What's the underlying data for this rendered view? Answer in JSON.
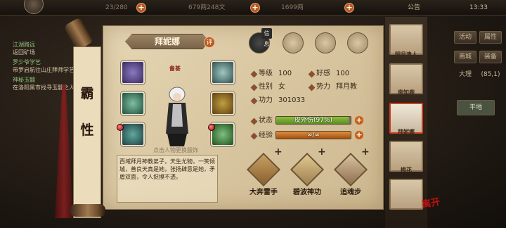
{
  "topbar": {
    "energy": "23/280",
    "copper": "679两248文",
    "gold": "1699两",
    "notice": "公告",
    "time": "13:33"
  },
  "quests": [
    {
      "title": "江湖路远",
      "body": "返回矿场"
    },
    {
      "title": "罗少爷学艺",
      "body": "带罗启航往山庄拜师学艺"
    },
    {
      "title": "神秘玉髓",
      "body": "在洛阳黑市找寻玉髓之人"
    }
  ],
  "left_title": [
    "霸",
    "性"
  ],
  "character": {
    "name": "拜妮娜",
    "rate_badge": "评",
    "wear_label": "备甚",
    "hint": "点击人物更换服饰",
    "description": "西域拜月神教弟子，天生尤物，一笑倾城，善良天真是她，张扬肆意是她，矛盾双面，令人捉摸不透。"
  },
  "seal_badge": "信息",
  "stats": {
    "level_label": "等级",
    "level": "100",
    "favor_label": "好感",
    "favor": "100",
    "gender_label": "性别",
    "gender": "女",
    "force_label": "势力",
    "force": "拜月教",
    "power_label": "功力",
    "power": "301033",
    "status_label": "状态",
    "status_text": "皮外伤(97%)",
    "status_pct": 97,
    "exp_label": "经验",
    "exp_text": "∞/∞",
    "exp_pct": 100
  },
  "skills": [
    "大奔雷手",
    "碧波神功",
    "追魂步"
  ],
  "right_buttons": [
    "活动",
    "属性",
    "商城",
    "装备",
    "大理",
    "(85,1)",
    "平地"
  ],
  "portraits": [
    "明月逢人",
    "南知鹿",
    "拜妮娜",
    "桃花",
    ""
  ],
  "leave_label": "离开"
}
